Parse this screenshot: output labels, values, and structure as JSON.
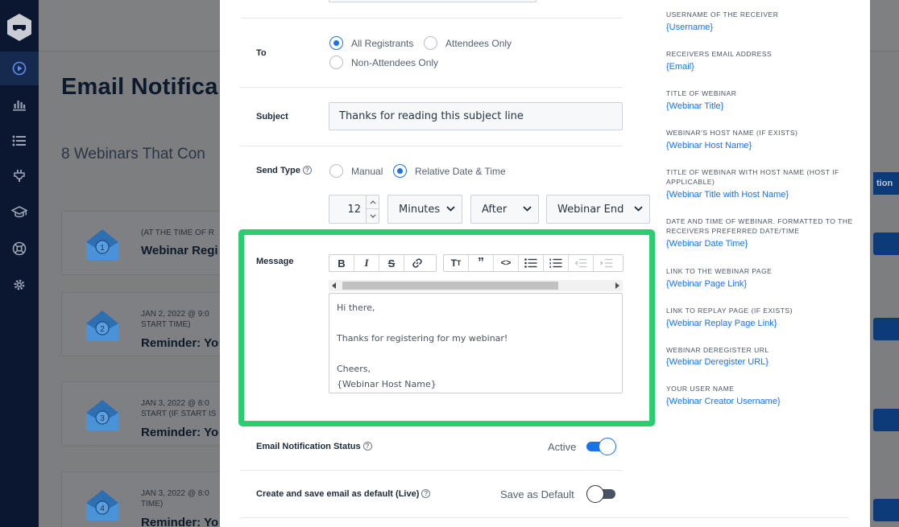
{
  "background": {
    "page_title": "Email Notifica",
    "count_title": "8 Webinars That Con",
    "right_tab": "tion",
    "cards": [
      {
        "num": "1",
        "meta1": "(AT THE TIME OF R",
        "meta2": "",
        "name": "Webinar Regi"
      },
      {
        "num": "2",
        "meta1": "JAN 2, 2022 @ 9:0",
        "meta2": "START TIME)",
        "name": "Reminder: Yo"
      },
      {
        "num": "3",
        "meta1": "JAN 3, 2022 @ 8:0",
        "meta2": "START (IF START IS",
        "name": "Reminder: Yo"
      },
      {
        "num": "4",
        "meta1": "JAN 3, 2022 @ 8:0",
        "meta2": "TIME)",
        "name": "Reminder: Yo"
      }
    ]
  },
  "form": {
    "to": {
      "label": "To",
      "options": [
        {
          "label": "All Registrants",
          "selected": true
        },
        {
          "label": "Attendees Only",
          "selected": false
        },
        {
          "label": "Non-Attendees Only",
          "selected": false
        }
      ]
    },
    "subject": {
      "label": "Subject",
      "value": "Thanks for reading this subject line"
    },
    "send_type": {
      "label": "Send Type",
      "help": "?",
      "options": [
        {
          "label": "Manual",
          "selected": false
        },
        {
          "label": "Relative Date & Time",
          "selected": true
        }
      ],
      "amount": "12",
      "unit": "Minutes",
      "relation": "After",
      "event": "Webinar End"
    },
    "message": {
      "label": "Message",
      "toolbar": [
        "B",
        "I",
        "S",
        "link",
        "T",
        "”",
        "<>",
        "ul",
        "ol",
        "outdent",
        "indent"
      ],
      "lines": [
        "Hi there,",
        "",
        "Thanks for registering for my webinar!",
        "",
        "Cheers,",
        "{Webinar Host Name}"
      ]
    },
    "status": {
      "label": "Email Notification Status",
      "help": "?",
      "state_label": "Active",
      "on": true
    },
    "default": {
      "label": "Create and save email as default (Live)",
      "help": "?",
      "state_label": "Save as Default",
      "on": false
    }
  },
  "variables": [
    {
      "label": "USERNAME OF THE RECEIVER",
      "token": "{Username}"
    },
    {
      "label": "RECEIVERS EMAIL ADDRESS",
      "token": "{Email}"
    },
    {
      "label": "TITLE OF WEBINAR",
      "token": "{Webinar Title}"
    },
    {
      "label": "WEBINAR'S HOST NAME (IF EXISTS)",
      "token": "{Webinar Host Name}"
    },
    {
      "label": "TITLE OF WEBINAR WITH HOST NAME (HOST IF APPLICABLE)",
      "token": "{Webinar Title with Host Name}"
    },
    {
      "label": "DATE AND TIME OF WEBINAR. FORMATTED TO THE RECEIVERS PREFERRED DATE/TIME",
      "token": "{Webinar Date Time}"
    },
    {
      "label": "LINK TO THE WEBINAR PAGE",
      "token": "{Webinar Page Link}"
    },
    {
      "label": "LINK TO REPLAY PAGE (IF EXISTS)",
      "token": "{Webinar Replay Page Link}"
    },
    {
      "label": "WEBINAR DEREGISTER URL",
      "token": "{Webinar Deregister URL}"
    },
    {
      "label": "YOUR USER NAME",
      "token": "{Webinar Creator Username}"
    }
  ],
  "colors": {
    "accent": "#1a73e8",
    "highlight": "#2ecc71",
    "nav": "#0b1630"
  }
}
